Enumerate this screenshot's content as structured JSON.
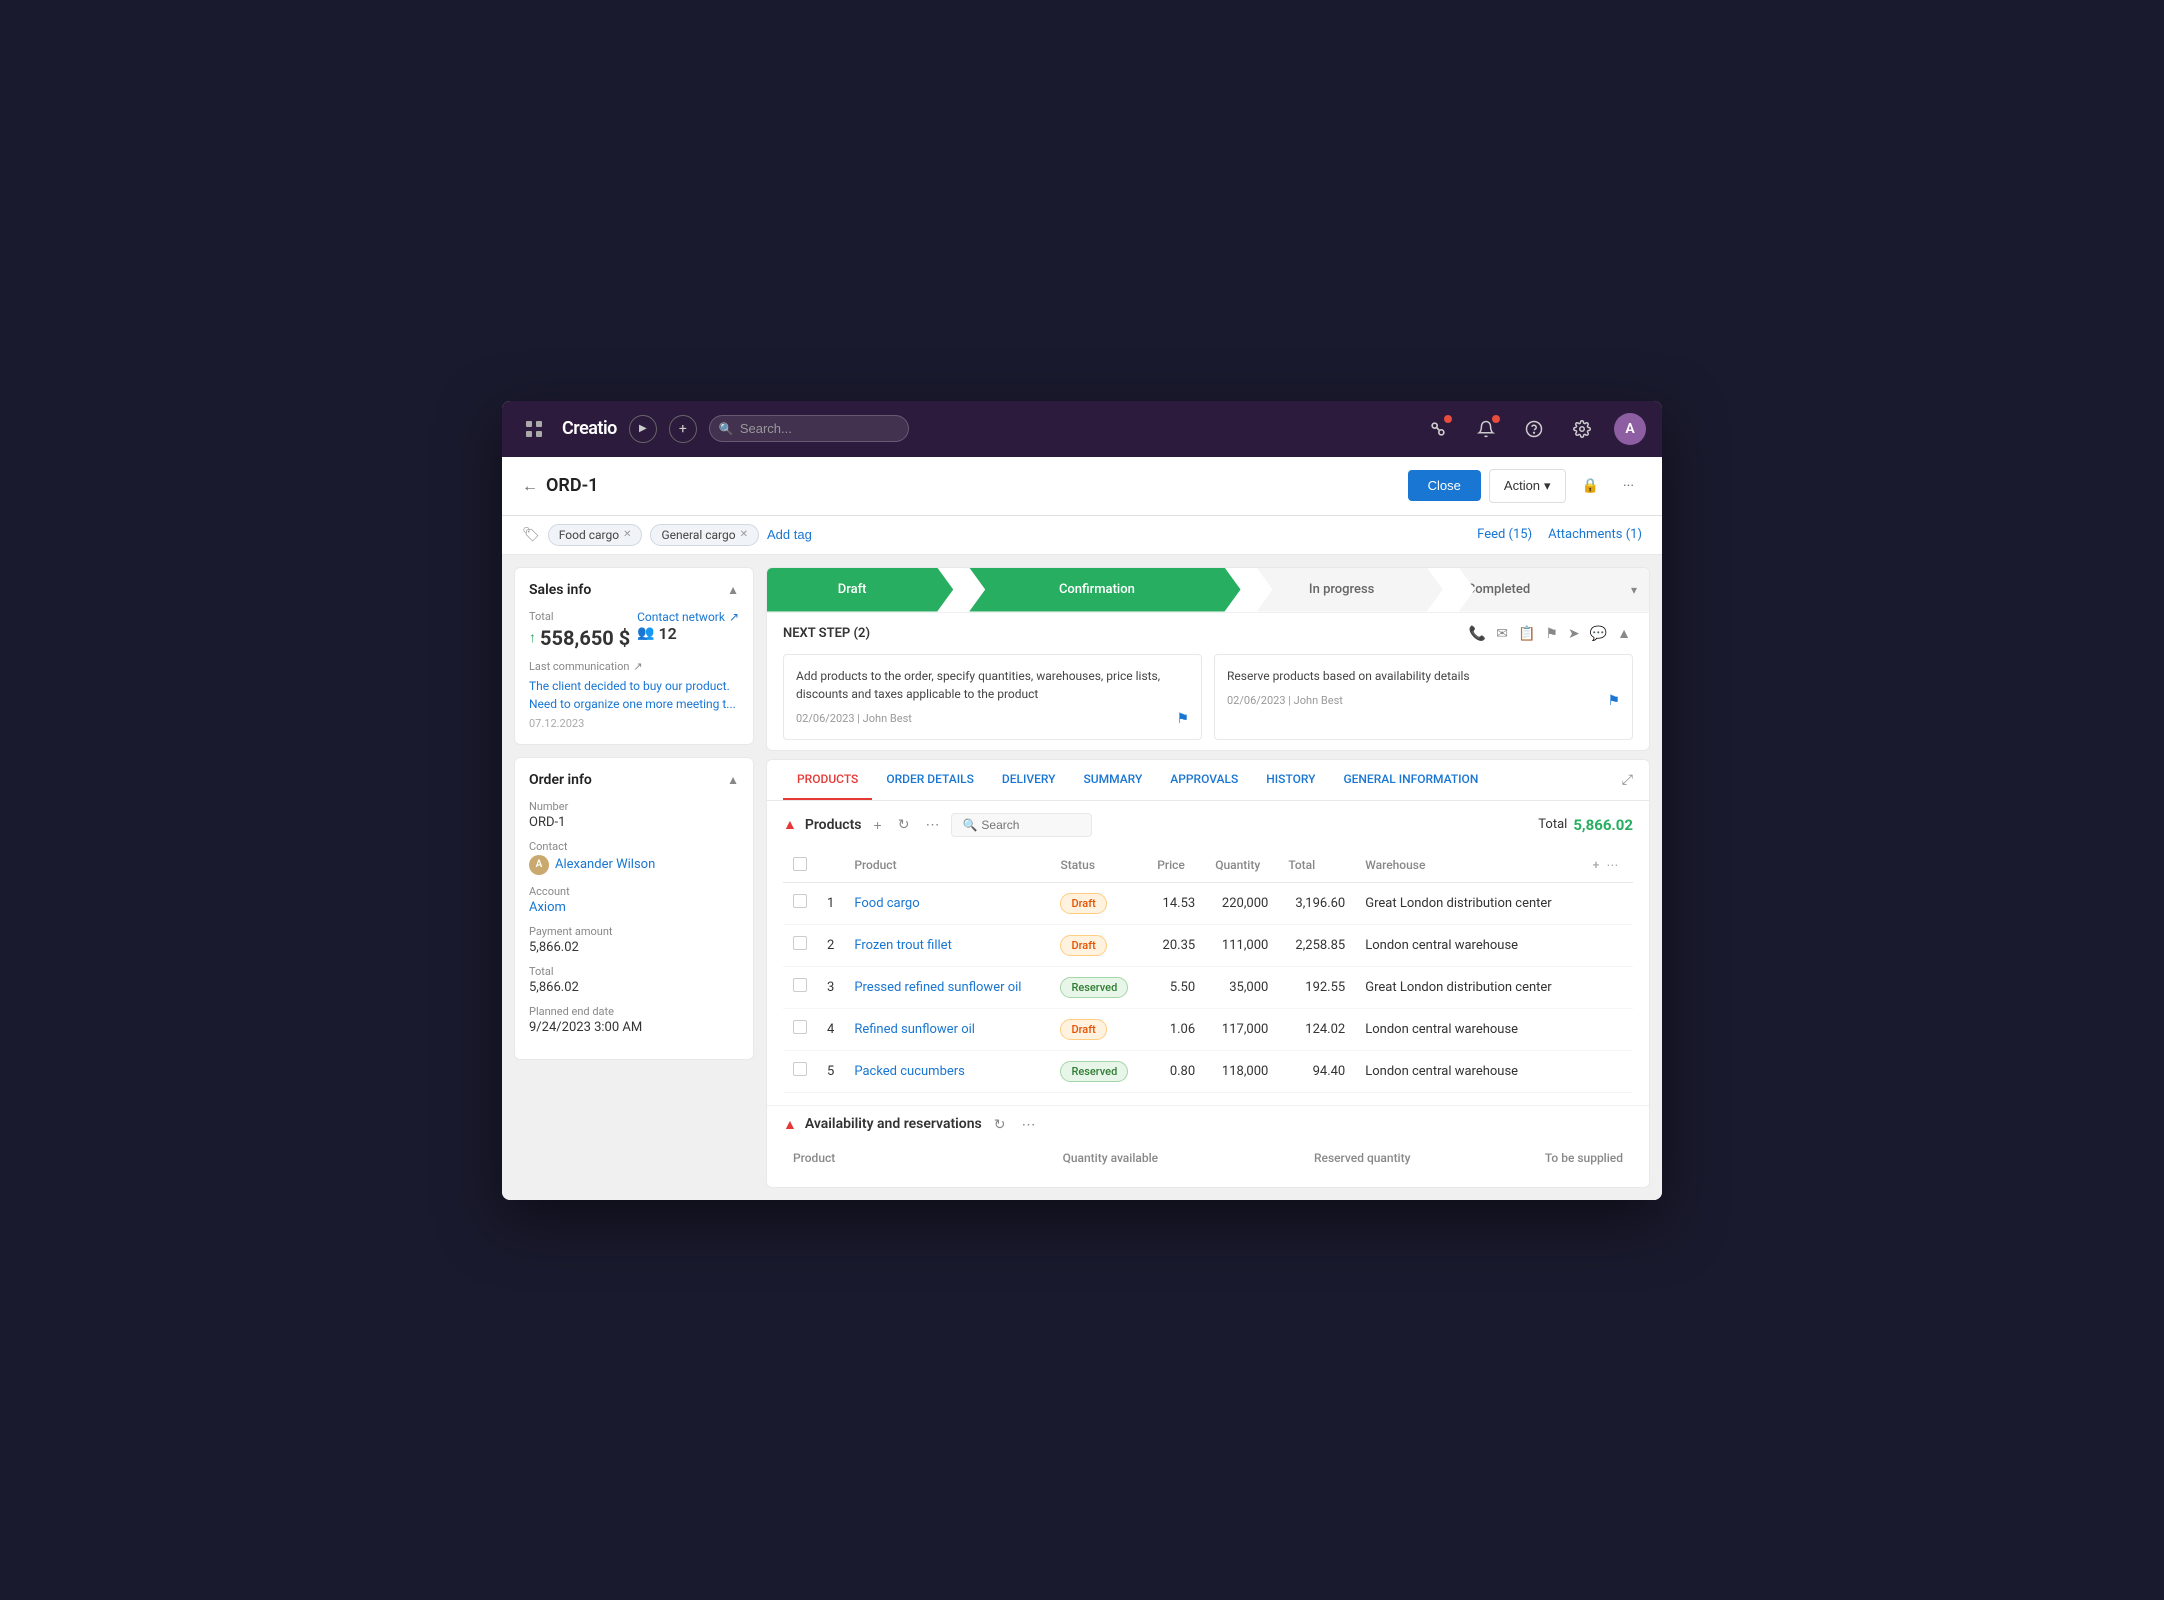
{
  "app": {
    "logo": "Creatio",
    "search_placeholder": "Search..."
  },
  "topnav": {
    "feed_label": "Feed (15)",
    "attachments_label": "Attachments (1)"
  },
  "page": {
    "back_label": "←",
    "title": "ORD-1",
    "close_btn": "Close",
    "action_btn": "Action",
    "tags": [
      "Food cargo",
      "General cargo"
    ],
    "add_tag": "Add tag"
  },
  "stages": {
    "draft": "Draft",
    "confirmation": "Confirmation",
    "inprogress": "In progress",
    "completed": "Completed"
  },
  "next_steps": {
    "label": "NEXT STEP (2)",
    "steps": [
      {
        "text": "Add products to the order, specify quantities, warehouses, price lists, discounts and taxes applicable to the product",
        "meta": "02/06/2023 | John Best"
      },
      {
        "text": "Reserve products based on availability details",
        "meta": "02/06/2023 | John Best"
      }
    ]
  },
  "sales_info": {
    "title": "Sales info",
    "total_label": "Total",
    "amount": "558,650 $",
    "contact_network_label": "Contact network",
    "contact_count": "12",
    "last_communication_label": "Last communication",
    "comm_text": "The client decided to buy our product. Need to organize one more meeting t...",
    "comm_date": "07.12.2023"
  },
  "order_info": {
    "title": "Order info",
    "number_label": "Number",
    "number": "ORD-1",
    "contact_label": "Contact",
    "contact_name": "Alexander Wilson",
    "account_label": "Account",
    "account_name": "Axiom",
    "payment_label": "Payment amount",
    "payment_amount": "5,866.02",
    "total_label": "Total",
    "total": "5,866.02",
    "planned_end_label": "Planned end date",
    "planned_end": "9/24/2023 3:00 AM"
  },
  "tabs": [
    {
      "id": "products",
      "label": "PRODUCTS",
      "active": true
    },
    {
      "id": "order_details",
      "label": "ORDER DETAILS",
      "active": false
    },
    {
      "id": "delivery",
      "label": "DELIVERY",
      "active": false
    },
    {
      "id": "summary",
      "label": "SUMMARY",
      "active": false
    },
    {
      "id": "approvals",
      "label": "APPROVALS",
      "active": false
    },
    {
      "id": "history",
      "label": "HISTORY",
      "active": false
    },
    {
      "id": "general_info",
      "label": "GENERAL INFORMATION",
      "active": false
    }
  ],
  "products": {
    "section_title": "Products",
    "search_placeholder": "Search",
    "total_label": "Total",
    "total_value": "5,866.02",
    "columns": [
      "Product",
      "Status",
      "Price",
      "Quantity",
      "Total",
      "Warehouse"
    ],
    "rows": [
      {
        "num": "1",
        "product": "Food cargo",
        "status": "Draft",
        "status_type": "draft",
        "price": "14.53",
        "quantity": "220,000",
        "total": "3,196.60",
        "warehouse": "Great London distribution center"
      },
      {
        "num": "2",
        "product": "Frozen trout fillet",
        "status": "Draft",
        "status_type": "draft",
        "price": "20.35",
        "quantity": "111,000",
        "total": "2,258.85",
        "warehouse": "London central warehouse"
      },
      {
        "num": "3",
        "product": "Pressed refined sunflower oil",
        "status": "Reserved",
        "status_type": "reserved",
        "price": "5.50",
        "quantity": "35,000",
        "total": "192.55",
        "warehouse": "Great London distribution center"
      },
      {
        "num": "4",
        "product": "Refined sunflower oil",
        "status": "Draft",
        "status_type": "draft",
        "price": "1.06",
        "quantity": "117,000",
        "total": "124.02",
        "warehouse": "London central warehouse"
      },
      {
        "num": "5",
        "product": "Packed cucumbers",
        "status": "Reserved",
        "status_type": "reserved",
        "price": "0.80",
        "quantity": "118,000",
        "total": "94.40",
        "warehouse": "London central warehouse"
      }
    ]
  },
  "availability": {
    "title": "Availability and reservations",
    "columns": [
      "Product",
      "Quantity available",
      "Reserved quantity",
      "To be supplied"
    ]
  }
}
